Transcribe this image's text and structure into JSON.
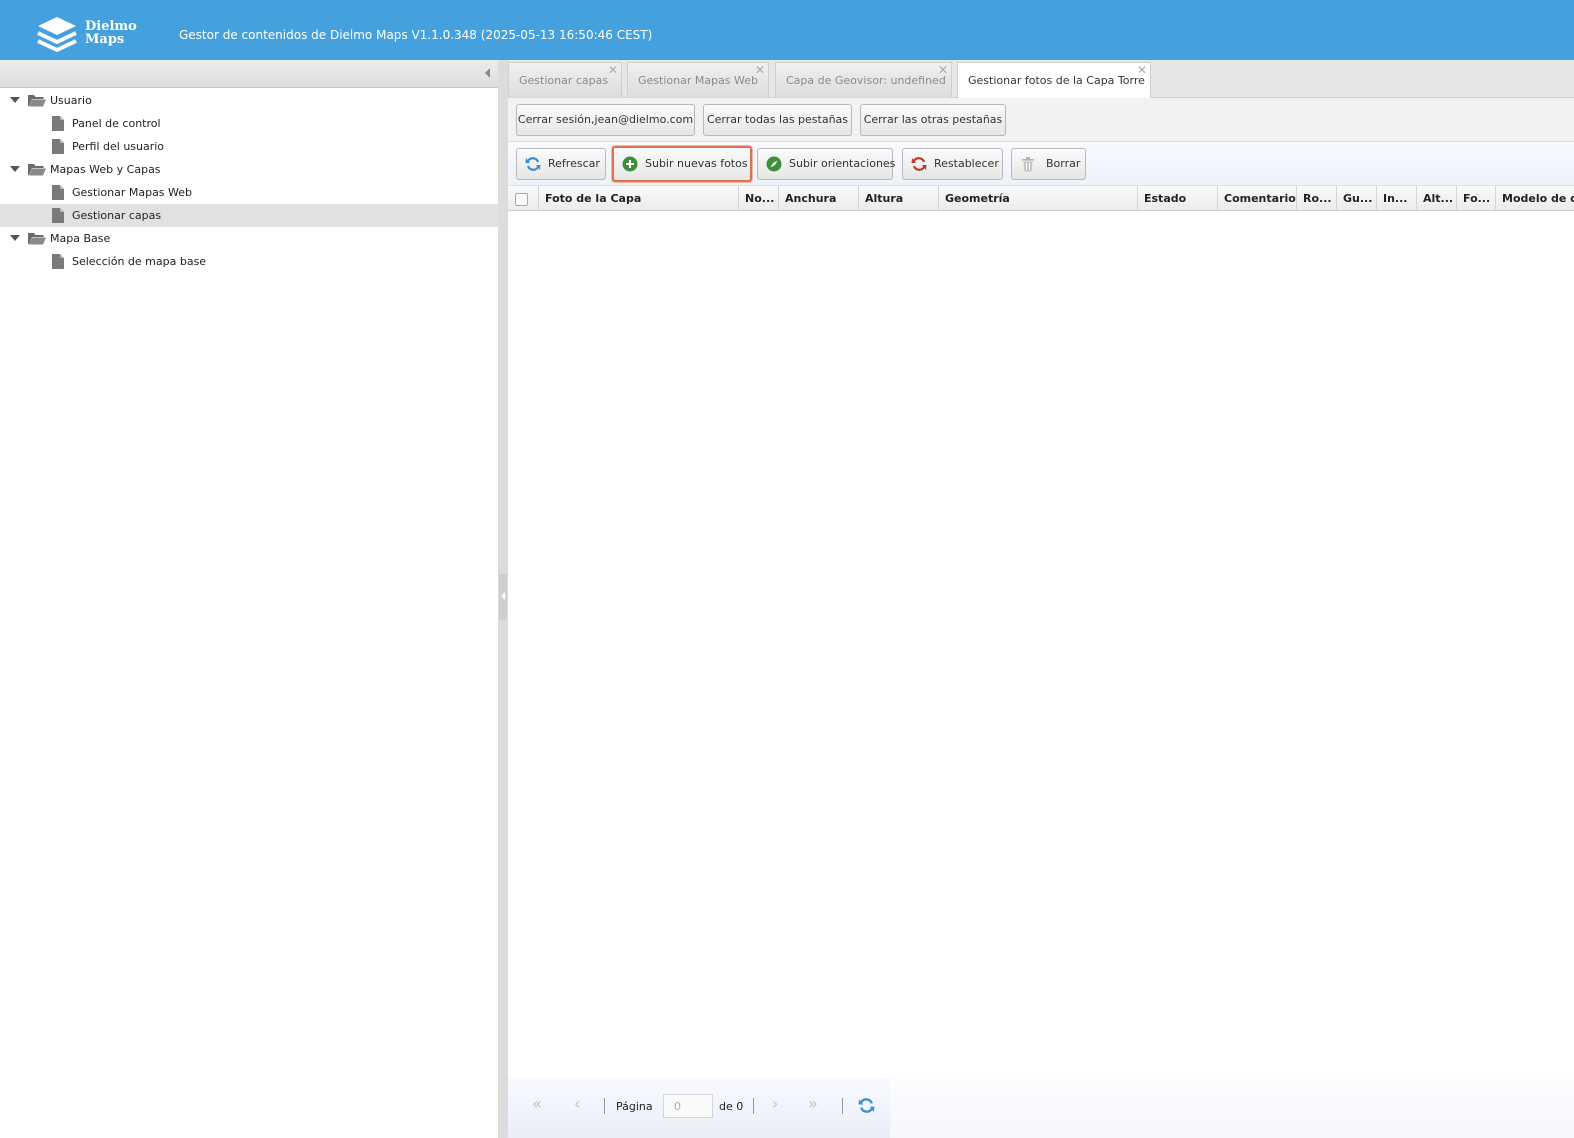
{
  "header": {
    "logo_line1": "Dielmo",
    "logo_line2": "Maps",
    "title": "Gestor de contenidos de Dielmo Maps V1.1.0.348 (2025-05-13 16:50:46 CEST)"
  },
  "tree": {
    "items": [
      {
        "label": "Usuario"
      },
      {
        "label": "Panel de control"
      },
      {
        "label": "Perfil del usuario"
      },
      {
        "label": "Mapas Web y Capas"
      },
      {
        "label": "Gestionar Mapas Web"
      },
      {
        "label": "Gestionar capas"
      },
      {
        "label": "Mapa Base"
      },
      {
        "label": "Selección de mapa base"
      }
    ]
  },
  "tabs": [
    {
      "label": "Gestionar capas"
    },
    {
      "label": "Gestionar Mapas Web"
    },
    {
      "label": "Capa de Geovisor: undefined"
    },
    {
      "label": "Gestionar fotos de la Capa Torre"
    }
  ],
  "toolbar1": {
    "logout": "Cerrar sesión,jean@dielmo.com",
    "close_all": "Cerrar todas las pestañas",
    "close_others": "Cerrar las otras pestañas"
  },
  "toolbar2": {
    "refresh": "Refrescar",
    "upload_photos": "Subir nuevas fotos",
    "upload_orientations": "Subir orientaciones",
    "reset": "Restablecer",
    "delete": "Borrar"
  },
  "grid": {
    "columns": [
      "Foto de la Capa",
      "No...",
      "Anchura",
      "Altura",
      "Geometría",
      "Estado",
      "Comentario",
      "Ro...",
      "Gu...",
      "In...",
      "Alt...",
      "Fo...",
      "Modelo de d"
    ]
  },
  "pager": {
    "page_label": "Página",
    "page_value": "0",
    "of_label": "de 0"
  },
  "colors": {
    "header_bg": "#45a1dd",
    "highlight_border": "#e0704e",
    "refresh_icon": "#3a8fd0",
    "add_icon": "#3f8f3a",
    "reset_icon": "#c0392b"
  }
}
